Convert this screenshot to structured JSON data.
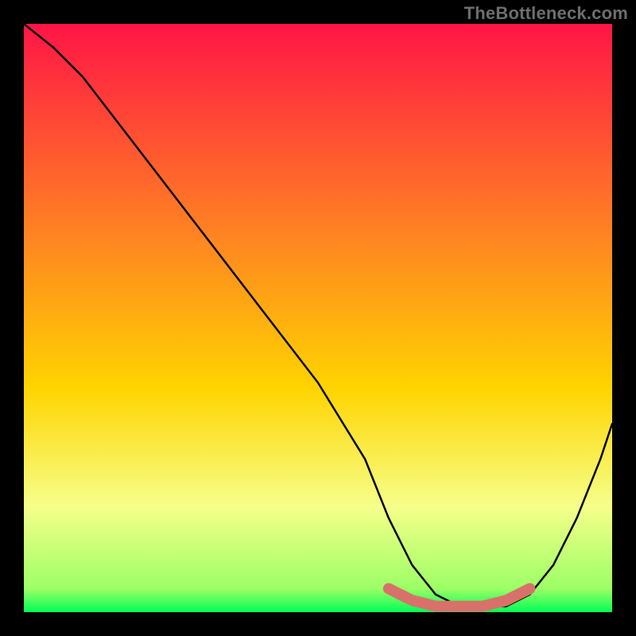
{
  "watermark": "TheBottleneck.com",
  "colors": {
    "gradient_top": "#ff1546",
    "gradient_mid": "#ffd400",
    "gradient_low": "#f6ff8a",
    "gradient_bottom": "#00ff55",
    "curve": "#000000",
    "highlight": "#d9716b",
    "frame": "#000000"
  },
  "chart_data": {
    "type": "line",
    "title": "",
    "xlabel": "",
    "ylabel": "",
    "xlim": [
      0,
      100
    ],
    "ylim": [
      0,
      100
    ],
    "series": [
      {
        "name": "bottleneck-curve",
        "x": [
          0,
          5,
          10,
          20,
          30,
          40,
          50,
          58,
          62,
          66,
          70,
          74,
          78,
          82,
          86,
          90,
          94,
          98,
          100
        ],
        "values": [
          100,
          96,
          91,
          78,
          65,
          52,
          39,
          26,
          16,
          8,
          3,
          1,
          1,
          1,
          3,
          8,
          16,
          26,
          32
        ]
      }
    ],
    "highlight_segment": {
      "name": "optimal-range",
      "x": [
        62,
        66,
        70,
        74,
        78,
        82,
        86
      ],
      "values": [
        4,
        2,
        1,
        1,
        1,
        2,
        4
      ]
    }
  }
}
